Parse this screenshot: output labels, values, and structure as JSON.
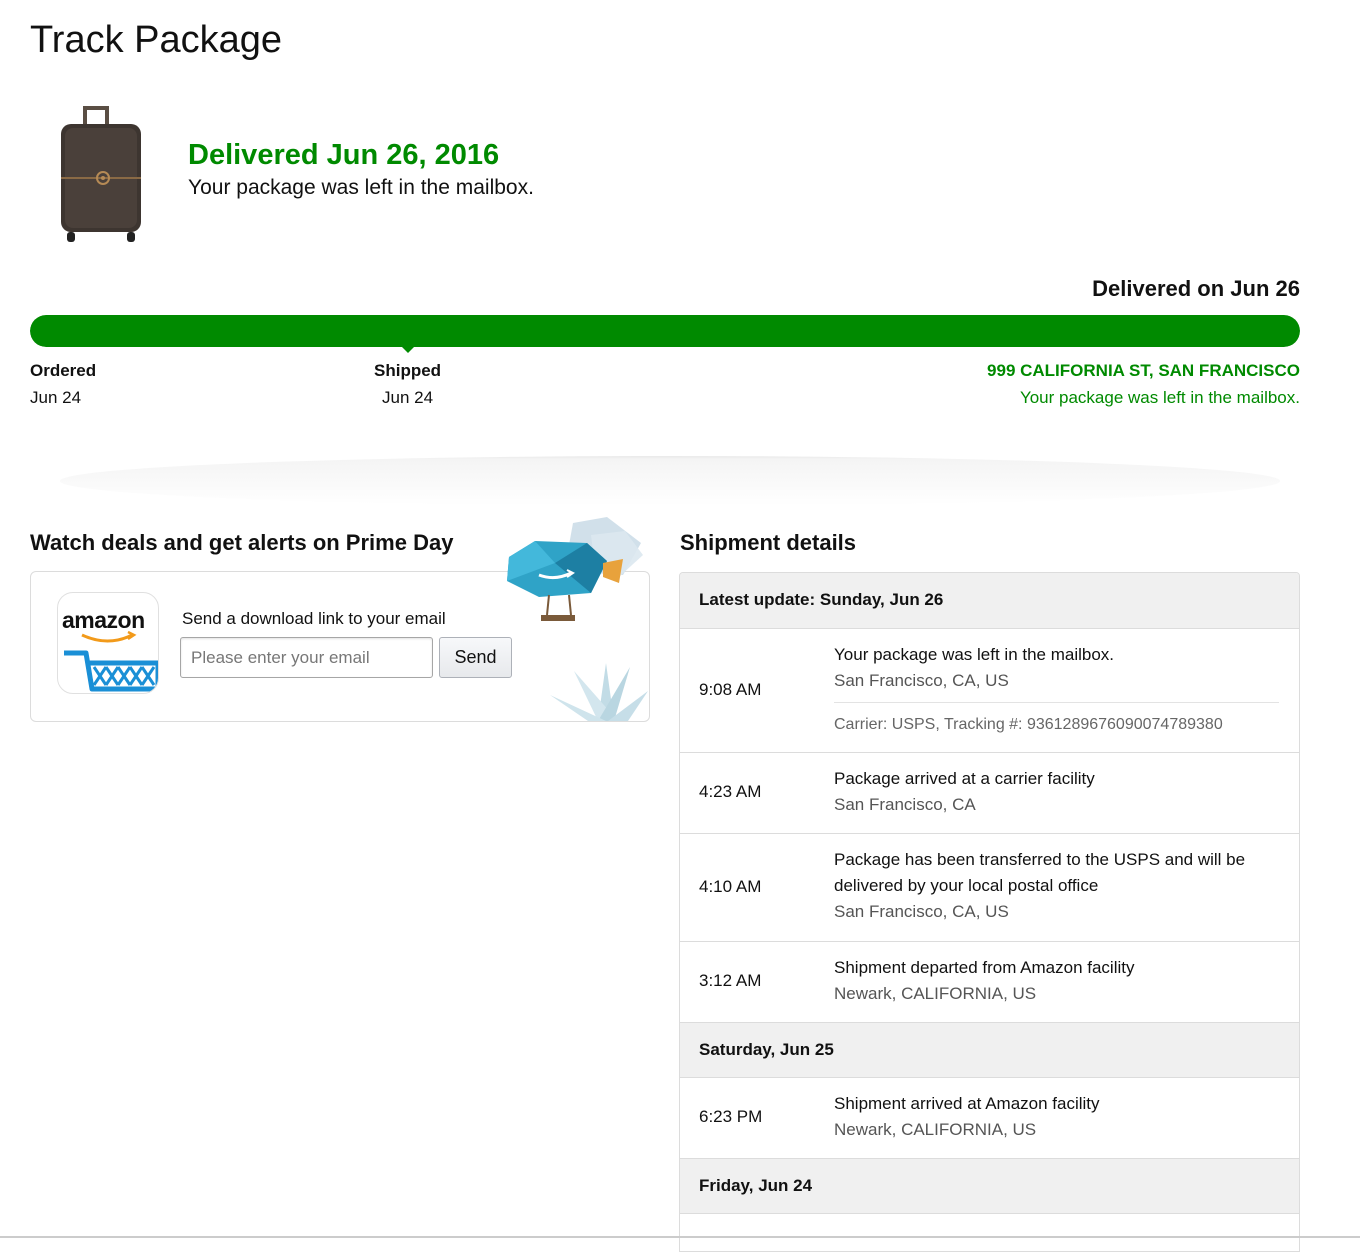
{
  "page": {
    "title": "Track Package"
  },
  "status": {
    "headline": "Delivered Jun 26, 2016",
    "subtext": "Your package was left in the mailbox.",
    "delivered_on": "Delivered on Jun 26"
  },
  "progress": {
    "fraction_complete": 1.0,
    "color": "#008a00",
    "stages": [
      {
        "label": "Ordered",
        "date": "Jun 24"
      },
      {
        "label": "Shipped",
        "date": "Jun 24"
      }
    ],
    "destination": {
      "address": "999 CALIFORNIA ST, SAN FRANCISCO",
      "note": "Your package was left in the mailbox."
    }
  },
  "promo": {
    "title": "Watch deals and get alerts on Prime Day",
    "app_icon_text": "amazon",
    "send_prompt": "Send a download link to your email",
    "email_placeholder": "Please enter your email",
    "send_label": "Send",
    "icons": [
      "amazon-cart-icon",
      "blimp-illustration",
      "snowflake-illustration"
    ]
  },
  "shipment": {
    "title": "Shipment details",
    "groups": [
      {
        "date": "Latest update: Sunday, Jun 26",
        "events": [
          {
            "time": "9:08 AM",
            "description": "Your package was left in the mailbox.",
            "location": "San Francisco, CA, US",
            "carrier": "Carrier: USPS, Tracking #: 9361289676090074789380"
          },
          {
            "time": "4:23 AM",
            "description": "Package arrived at a carrier facility",
            "location": "San Francisco, CA"
          },
          {
            "time": "4:10 AM",
            "description": "Package has been transferred to the USPS and will be delivered by your local postal office",
            "location": "San Francisco, CA, US"
          },
          {
            "time": "3:12 AM",
            "description": "Shipment departed from Amazon facility",
            "location": "Newark, CALIFORNIA, US"
          }
        ]
      },
      {
        "date": "Saturday, Jun 25",
        "events": [
          {
            "time": "6:23 PM",
            "description": "Shipment arrived at Amazon facility",
            "location": "Newark, CALIFORNIA, US"
          }
        ]
      },
      {
        "date": "Friday, Jun 24",
        "events": []
      }
    ]
  }
}
